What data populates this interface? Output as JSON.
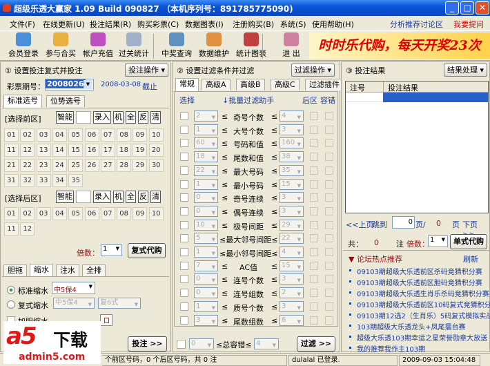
{
  "window": {
    "title": "超级乐透大赢家 1.09 Build 090827 （本机序列号：891785775090)"
  },
  "menu": [
    "文件(F)",
    "在线更新(U)",
    "投注结果(R)",
    "购买彩票(C)",
    "数据图表(I)",
    "注册购买(B)",
    "系统(S)",
    "使用帮助(H)"
  ],
  "menu_right": [
    "分析推荐讨论区",
    "我要提问"
  ],
  "toolbar": [
    {
      "label": "会员登录",
      "icon": "member-login-icon",
      "color": "#4a8fd8"
    },
    {
      "label": "参与合买",
      "icon": "join-buy-icon",
      "color": "#e8b040"
    },
    {
      "label": "帐户充值",
      "icon": "recharge-icon",
      "color": "#c050c0"
    },
    {
      "label": "过关统计",
      "icon": "book-icon",
      "color": "#a0b0c8"
    },
    {
      "label": "中奖查询",
      "icon": "search-icon",
      "color": "#6090c0"
    },
    {
      "label": "数据维护",
      "icon": "clipboard-icon",
      "color": "#e09040"
    },
    {
      "label": "统计图表",
      "icon": "chart-icon",
      "color": "#c04040"
    },
    {
      "label": "退 出",
      "icon": "exit-door-icon",
      "color": "#d080a0"
    }
  ],
  "banner": "时时乐代购，每天开奖23次",
  "left": {
    "title": "① 设置投注复式并投注",
    "op_button": "投注操作 ▾",
    "period_label": "彩票期号：",
    "period": "2008026",
    "deadline_date": "2008-03-08",
    "deadline_link": "截止",
    "tabs": [
      "标准选号",
      "位势选号"
    ],
    "front_label": "[选择前区]",
    "back_label": "[选择后区]",
    "tools": [
      "智能",
      "录入",
      "机",
      "全",
      "反",
      "清"
    ],
    "front_numbers": [
      "01",
      "02",
      "03",
      "04",
      "05",
      "06",
      "07",
      "08",
      "09",
      "10",
      "11",
      "12",
      "13",
      "14",
      "15",
      "16",
      "17",
      "18",
      "19",
      "20",
      "21",
      "22",
      "23",
      "24",
      "25",
      "26",
      "27",
      "28",
      "29",
      "30",
      "31",
      "32",
      "33",
      "34",
      "35"
    ],
    "back_numbers": [
      "01",
      "02",
      "03",
      "04",
      "05",
      "06",
      "07",
      "08",
      "09",
      "10",
      "11",
      "12"
    ],
    "multiple_label": "倍数：",
    "multiple": "1",
    "buy_button": "复式代购",
    "bottom_tabs": [
      "胆拖",
      "缩水",
      "注水",
      "全排"
    ],
    "opt1": "标准缩水",
    "opt1_value": "中5保4",
    "opt2": "复式缩水",
    "opt2_value": "中5保4",
    "opt2_value2": "复6式",
    "opt3": "加胆缩水",
    "submit": "投注 >>"
  },
  "middle": {
    "title": "② 设置过滤条件并过滤",
    "op_button": "过滤操作 ▾",
    "tabs": [
      "常规",
      "高级A",
      "高级B",
      "高级C",
      "过滤插件"
    ],
    "col_select": "选择",
    "col_helper": "↓批量过滤助手",
    "col_back": "后区",
    "col_tol": "容错",
    "rows": [
      {
        "name": "奇号个数",
        "min": "2",
        "max": "4"
      },
      {
        "name": "大号个数",
        "min": "1",
        "max": "3"
      },
      {
        "name": "号码和值",
        "min": "60",
        "max": "160"
      },
      {
        "name": "尾数和值",
        "min": "18",
        "max": "38"
      },
      {
        "name": "最大号码",
        "min": "22",
        "max": "35"
      },
      {
        "name": "最小号码",
        "min": "1",
        "max": "15"
      },
      {
        "name": "奇号连续",
        "min": "0",
        "max": "3"
      },
      {
        "name": "偶号连续",
        "min": "0",
        "max": "3"
      },
      {
        "name": "极号间距",
        "min": "10",
        "max": "29"
      },
      {
        "name": "最大邻号间距",
        "min": "5",
        "max": "22"
      },
      {
        "name": "最小邻号间距",
        "min": "1",
        "max": "4"
      },
      {
        "name": "AC值",
        "min": "7",
        "max": "15"
      },
      {
        "name": "连号个数",
        "min": "0",
        "max": "3"
      },
      {
        "name": "连号组数",
        "min": "0",
        "max": "2"
      },
      {
        "name": "质号个数",
        "min": "1",
        "max": "3"
      },
      {
        "name": "尾数组数",
        "min": "3",
        "max": "6"
      }
    ],
    "total_label": "≤总容错≤",
    "total_min": "0",
    "total_max": "4",
    "le": "≤",
    "filter_button": "过滤 >>"
  },
  "right": {
    "title": "③ 投注结果",
    "op_button": "结果处理 ▾",
    "col1": "注号",
    "col2": "投注结果",
    "prev": "<<上页",
    "jump": "跳到",
    "page": "0",
    "page_sep": "页/",
    "page_total": "0",
    "page_unit": "页",
    "next": "下页>>",
    "total_label": "共：",
    "total": "0",
    "unit": "注",
    "multiple_label": "倍数：",
    "multiple": "1",
    "buy_button": "单式代购",
    "forum_title": "▼ 论坛热点推荐",
    "refresh": "刷新",
    "forum": [
      "09103期超级大乐透前区杀码竞猜积分赛",
      "09103期超级大乐透前区胆码竞猜积分赛",
      "09103期超级大乐透生肖乐杀码竞猜积分赛",
      "09103期超级大乐透前区10码复式竞猜积分赛",
      "09103期12选2（生肖乐）5码复式模拟实战",
      "103期超级大乐透龙头+凤尾擂台赛",
      "超级大乐透103期幸运之星荣誉勋章大放送",
      "我的推荐我作主103期"
    ]
  },
  "status": {
    "selection": "个前区号码，0 个后区号码，共 0 注",
    "user": "dulalal 已登录.",
    "time": "2009-09-03 15:04:48"
  },
  "watermark": {
    "logo": "a5下载",
    "site": "admin5.com"
  },
  "colors": {
    "title_bar": "#0a54d8",
    "selection": "#2860c8",
    "accent_red": "#a01010",
    "link": "#1a3a9c"
  }
}
